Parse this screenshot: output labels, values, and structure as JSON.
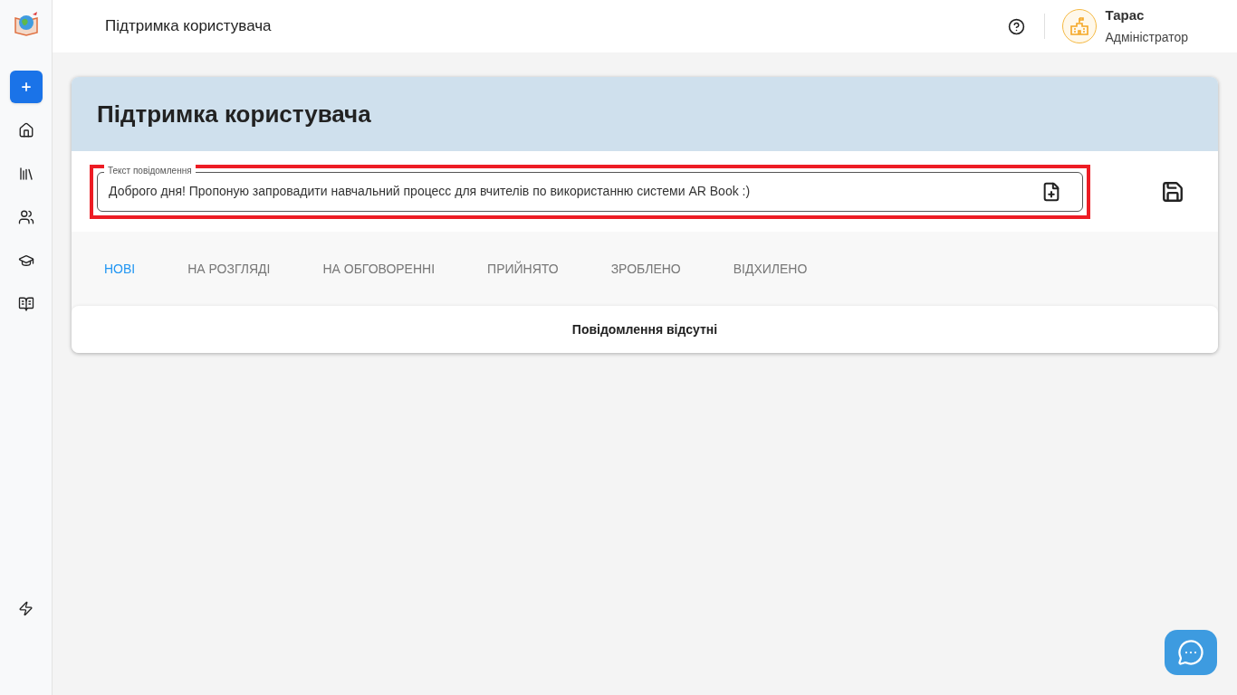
{
  "header": {
    "title": "Підтримка користувача",
    "user": {
      "name": "Тарас",
      "role": "Адміністратор"
    }
  },
  "sidebar": {
    "items": [
      {
        "kind": "add",
        "selected": true
      },
      {
        "kind": "home",
        "selected": false
      },
      {
        "kind": "library",
        "selected": false
      },
      {
        "kind": "users",
        "selected": false
      },
      {
        "kind": "courses",
        "selected": false
      },
      {
        "kind": "book",
        "selected": false
      }
    ]
  },
  "card": {
    "title": "Підтримка користувача",
    "message_field": {
      "label": "Текст повідомлення",
      "value": "Доброго дня! Пропоную запровадити навчальний процесс для вчителів по використанню системи AR Book :)",
      "highlighted": true
    },
    "tabs": [
      {
        "label": "НОВІ",
        "selected": true
      },
      {
        "label": "НА РОЗГЛЯДІ",
        "selected": false
      },
      {
        "label": "НА ОБГОВОРЕННІ",
        "selected": false
      },
      {
        "label": "ПРИЙНЯТО",
        "selected": false
      },
      {
        "label": "ЗРОБЛЕНО",
        "selected": false
      },
      {
        "label": "ВІДХИЛЕНО",
        "selected": false
      }
    ],
    "empty_message": "Повідомлення відсутні"
  }
}
